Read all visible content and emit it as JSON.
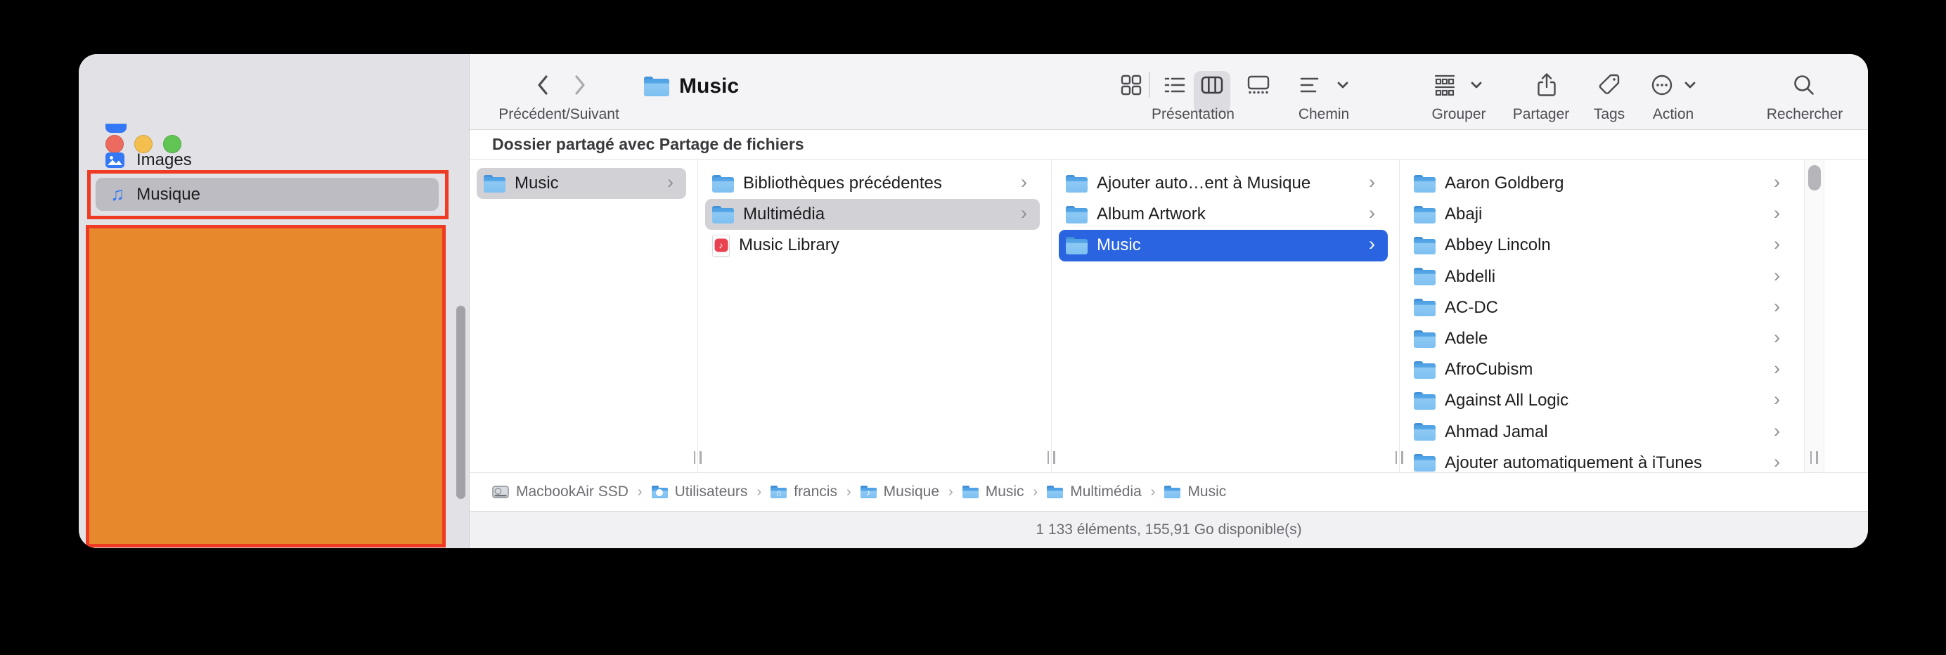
{
  "toolbar": {
    "back_forward_label": "Précédent/Suivant",
    "title": "Music",
    "view_label": "Présentation",
    "path_label": "Chemin",
    "group_label": "Grouper",
    "share_label": "Partager",
    "tags_label": "Tags",
    "action_label": "Action",
    "search_label": "Rechercher"
  },
  "sidebar": {
    "items": [
      {
        "label": "Images",
        "icon": "photo-icon",
        "selected": false
      },
      {
        "label": "Musique",
        "icon": "music-note-icon",
        "selected": true
      }
    ]
  },
  "banner": {
    "text": "Dossier partagé avec Partage de fichiers"
  },
  "columns": [
    {
      "items": [
        {
          "label": "Music",
          "icon": "folder",
          "selected": "gray",
          "chevron": true
        }
      ]
    },
    {
      "items": [
        {
          "label": "Bibliothèques précédentes",
          "icon": "folder",
          "selected": null,
          "chevron": true
        },
        {
          "label": "Multimédia",
          "icon": "folder",
          "selected": "gray",
          "chevron": true
        },
        {
          "label": "Music Library",
          "icon": "music-doc",
          "selected": null,
          "chevron": false
        }
      ]
    },
    {
      "items": [
        {
          "label": "Ajouter auto…ent à Musique",
          "icon": "folder",
          "selected": null,
          "chevron": true
        },
        {
          "label": "Album Artwork",
          "icon": "folder",
          "selected": null,
          "chevron": true
        },
        {
          "label": "Music",
          "icon": "folder",
          "selected": "blue",
          "chevron": true
        }
      ]
    },
    {
      "items": [
        {
          "label": "Aaron Goldberg",
          "icon": "folder",
          "selected": null,
          "chevron": true
        },
        {
          "label": "Abaji",
          "icon": "folder",
          "selected": null,
          "chevron": true
        },
        {
          "label": "Abbey Lincoln",
          "icon": "folder",
          "selected": null,
          "chevron": true
        },
        {
          "label": "Abdelli",
          "icon": "folder",
          "selected": null,
          "chevron": true
        },
        {
          "label": "AC-DC",
          "icon": "folder",
          "selected": null,
          "chevron": true
        },
        {
          "label": "Adele",
          "icon": "folder",
          "selected": null,
          "chevron": true
        },
        {
          "label": "AfroCubism",
          "icon": "folder",
          "selected": null,
          "chevron": true
        },
        {
          "label": "Against All Logic",
          "icon": "folder",
          "selected": null,
          "chevron": true
        },
        {
          "label": "Ahmad Jamal",
          "icon": "folder",
          "selected": null,
          "chevron": true
        },
        {
          "label": "Ajouter automatiquement à iTunes",
          "icon": "folder",
          "selected": null,
          "chevron": true
        }
      ]
    }
  ],
  "pathbar": {
    "items": [
      {
        "label": "MacbookAir SSD",
        "icon": "disk"
      },
      {
        "label": "Utilisateurs",
        "icon": "folder-users"
      },
      {
        "label": "francis",
        "icon": "folder-home"
      },
      {
        "label": "Musique",
        "icon": "folder-music"
      },
      {
        "label": "Music",
        "icon": "folder"
      },
      {
        "label": "Multimédia",
        "icon": "folder"
      },
      {
        "label": "Music",
        "icon": "folder"
      }
    ]
  },
  "statusbar": {
    "text": "1 133 éléments, 155,91 Go disponible(s)"
  },
  "colors": {
    "annotation_red": "#ef3b24",
    "annotation_orange_fill": "#e8882d",
    "selection_blue": "#2a64e0",
    "selection_gray": "#d2d1d6",
    "folder_blue": "#56a8e8",
    "accent_blue": "#3478f6"
  }
}
